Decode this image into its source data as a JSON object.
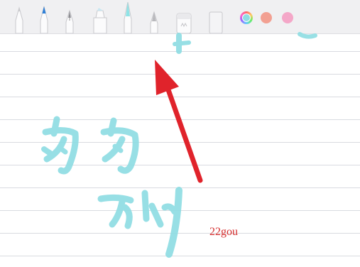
{
  "toolbar": {
    "tools": [
      {
        "name": "pencil-tool",
        "tip": "#c9c9cc"
      },
      {
        "name": "fineliner-pen-tool",
        "tip": "#2d7fd8"
      },
      {
        "name": "fountain-pen-tool",
        "tip": "#9a9aa0"
      },
      {
        "name": "marker-tool",
        "tip": "#c8e7f2"
      },
      {
        "name": "brush-pen-tool",
        "tip": "#8fe3e6"
      },
      {
        "name": "crayon-tool",
        "tip": "#b9b9bd"
      },
      {
        "name": "eraser-tool",
        "tip": "#e9e9ec"
      },
      {
        "name": "ruler-tool",
        "tip": "#f4f4f6"
      }
    ],
    "colors": {
      "selected": "rainbow",
      "swatch_salmon": "#f2a092",
      "swatch_pink": "#f4a7c8"
    }
  },
  "canvas": {
    "ink_color": "#8fdde3",
    "annotation_arrow_color": "#e0232b",
    "watermark_text": "22gou"
  }
}
